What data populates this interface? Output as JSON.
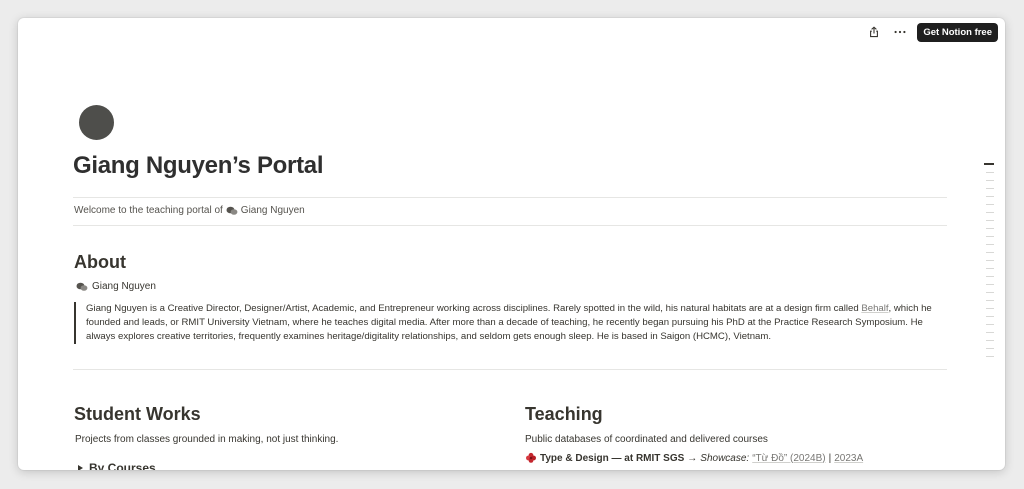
{
  "topbar": {
    "share_icon": "share-icon",
    "more_icon": "more-horizontal-icon",
    "cta_label": "Get Notion free"
  },
  "page": {
    "title": "Giang Nguyen’s Portal",
    "welcome_prefix": "Welcome to the teaching portal of",
    "welcome_mention": "Giang Nguyen"
  },
  "about": {
    "heading": "About",
    "author": "Giang Nguyen",
    "bio_part1": "Giang Nguyen is a Creative Director, Designer/Artist, Academic, and Entrepreneur working across disciplines. Rarely spotted in the wild, his natural habitats are at a design firm called ",
    "bio_link": "Behalf",
    "bio_part2": ", which he founded and leads, or RMIT University Vietnam, where he teaches digital media. After more than a decade of teaching, he recently began pursuing his PhD at the Practice Research Symposium. He always explores creative territories, frequently examines heritage/digitality relationships, and seldom gets enough sleep. He is based in Saigon (HCMC), Vietnam."
  },
  "student_works": {
    "heading": "Student Works",
    "description": "Projects from classes grounded in making, not just thinking.",
    "toggle_label": "By Courses"
  },
  "teaching": {
    "heading": "Teaching",
    "description": "Public databases of coordinated and delivered courses",
    "course_title": "Type & Design — at RMIT SGS",
    "arrow": "→",
    "showcase_label": "Showcase:",
    "showcase_link": "“Từ Đồ” (2024B)",
    "separator": "|",
    "link_2023": "2023A"
  },
  "colors": {
    "text": "#37352f",
    "cta_bg": "#1f1f1f",
    "avatar": "#4e4e4b",
    "muted": "#787774"
  }
}
